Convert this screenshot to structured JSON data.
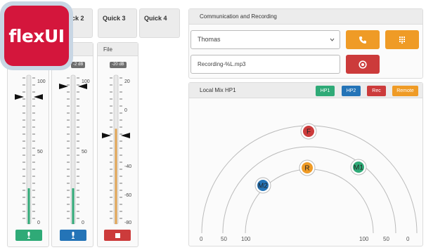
{
  "quick_tabs": [
    "Quick 2",
    "Quick 3",
    "Quick 4"
  ],
  "logo": {
    "text": "flexUI"
  },
  "strips": [
    {
      "name": "",
      "db": "",
      "scale": [
        "100",
        "50",
        "0"
      ],
      "level": 0.24,
      "button": "mic-icon",
      "color": "#2faa77"
    },
    {
      "name": "",
      "db": "-2 dB",
      "scale": [
        "100",
        "50",
        "0"
      ],
      "level": 0.24,
      "button": "mic-icon",
      "color": "#2474b7"
    },
    {
      "name": "File",
      "db": "-20 dB",
      "scale": [
        "20",
        "0",
        "-40",
        "-60",
        "-80"
      ],
      "level": 0.64,
      "button": "stop-icon",
      "color": "#cc3b3b"
    }
  ],
  "communication": {
    "title": "Communication and Recording",
    "contact": "Thomas",
    "recording_file": "Recording-%L.mp3",
    "call_button": "phone-icon",
    "dialpad_button": "dialpad-icon",
    "record_button": "record-icon"
  },
  "local_mix": {
    "title": "Local Mix HP1",
    "buttons": [
      {
        "label": "HP1",
        "color": "#2faa77"
      },
      {
        "label": "HP2",
        "color": "#2474b7"
      },
      {
        "label": "Rec",
        "color": "#cc3b3b"
      },
      {
        "label": "Remote",
        "color": "#ef9b26"
      }
    ],
    "axis_labels": [
      "0",
      "50",
      "100",
      "100",
      "50",
      "0"
    ],
    "nodes": [
      {
        "label": "F",
        "color": "#cc3b3b"
      },
      {
        "label": "R",
        "color": "#ef9b26"
      },
      {
        "label": "M1",
        "color": "#2faa77"
      },
      {
        "label": "M2",
        "color": "#2474b7"
      }
    ]
  }
}
